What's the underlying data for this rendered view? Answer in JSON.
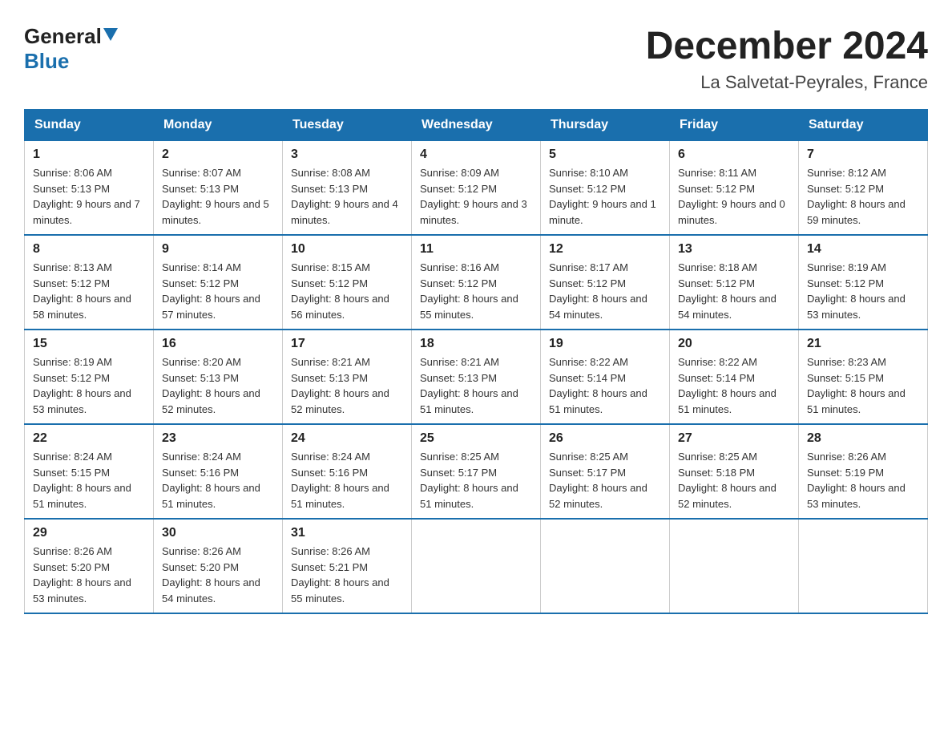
{
  "logo": {
    "general": "General",
    "blue": "Blue",
    "arrow_color": "#1a6fad"
  },
  "header": {
    "title": "December 2024",
    "subtitle": "La Salvetat-Peyrales, France"
  },
  "days_of_week": [
    "Sunday",
    "Monday",
    "Tuesday",
    "Wednesday",
    "Thursday",
    "Friday",
    "Saturday"
  ],
  "weeks": [
    [
      {
        "day": "1",
        "sunrise": "8:06 AM",
        "sunset": "5:13 PM",
        "daylight": "9 hours and 7 minutes."
      },
      {
        "day": "2",
        "sunrise": "8:07 AM",
        "sunset": "5:13 PM",
        "daylight": "9 hours and 5 minutes."
      },
      {
        "day": "3",
        "sunrise": "8:08 AM",
        "sunset": "5:13 PM",
        "daylight": "9 hours and 4 minutes."
      },
      {
        "day": "4",
        "sunrise": "8:09 AM",
        "sunset": "5:12 PM",
        "daylight": "9 hours and 3 minutes."
      },
      {
        "day": "5",
        "sunrise": "8:10 AM",
        "sunset": "5:12 PM",
        "daylight": "9 hours and 1 minute."
      },
      {
        "day": "6",
        "sunrise": "8:11 AM",
        "sunset": "5:12 PM",
        "daylight": "9 hours and 0 minutes."
      },
      {
        "day": "7",
        "sunrise": "8:12 AM",
        "sunset": "5:12 PM",
        "daylight": "8 hours and 59 minutes."
      }
    ],
    [
      {
        "day": "8",
        "sunrise": "8:13 AM",
        "sunset": "5:12 PM",
        "daylight": "8 hours and 58 minutes."
      },
      {
        "day": "9",
        "sunrise": "8:14 AM",
        "sunset": "5:12 PM",
        "daylight": "8 hours and 57 minutes."
      },
      {
        "day": "10",
        "sunrise": "8:15 AM",
        "sunset": "5:12 PM",
        "daylight": "8 hours and 56 minutes."
      },
      {
        "day": "11",
        "sunrise": "8:16 AM",
        "sunset": "5:12 PM",
        "daylight": "8 hours and 55 minutes."
      },
      {
        "day": "12",
        "sunrise": "8:17 AM",
        "sunset": "5:12 PM",
        "daylight": "8 hours and 54 minutes."
      },
      {
        "day": "13",
        "sunrise": "8:18 AM",
        "sunset": "5:12 PM",
        "daylight": "8 hours and 54 minutes."
      },
      {
        "day": "14",
        "sunrise": "8:19 AM",
        "sunset": "5:12 PM",
        "daylight": "8 hours and 53 minutes."
      }
    ],
    [
      {
        "day": "15",
        "sunrise": "8:19 AM",
        "sunset": "5:12 PM",
        "daylight": "8 hours and 53 minutes."
      },
      {
        "day": "16",
        "sunrise": "8:20 AM",
        "sunset": "5:13 PM",
        "daylight": "8 hours and 52 minutes."
      },
      {
        "day": "17",
        "sunrise": "8:21 AM",
        "sunset": "5:13 PM",
        "daylight": "8 hours and 52 minutes."
      },
      {
        "day": "18",
        "sunrise": "8:21 AM",
        "sunset": "5:13 PM",
        "daylight": "8 hours and 51 minutes."
      },
      {
        "day": "19",
        "sunrise": "8:22 AM",
        "sunset": "5:14 PM",
        "daylight": "8 hours and 51 minutes."
      },
      {
        "day": "20",
        "sunrise": "8:22 AM",
        "sunset": "5:14 PM",
        "daylight": "8 hours and 51 minutes."
      },
      {
        "day": "21",
        "sunrise": "8:23 AM",
        "sunset": "5:15 PM",
        "daylight": "8 hours and 51 minutes."
      }
    ],
    [
      {
        "day": "22",
        "sunrise": "8:24 AM",
        "sunset": "5:15 PM",
        "daylight": "8 hours and 51 minutes."
      },
      {
        "day": "23",
        "sunrise": "8:24 AM",
        "sunset": "5:16 PM",
        "daylight": "8 hours and 51 minutes."
      },
      {
        "day": "24",
        "sunrise": "8:24 AM",
        "sunset": "5:16 PM",
        "daylight": "8 hours and 51 minutes."
      },
      {
        "day": "25",
        "sunrise": "8:25 AM",
        "sunset": "5:17 PM",
        "daylight": "8 hours and 51 minutes."
      },
      {
        "day": "26",
        "sunrise": "8:25 AM",
        "sunset": "5:17 PM",
        "daylight": "8 hours and 52 minutes."
      },
      {
        "day": "27",
        "sunrise": "8:25 AM",
        "sunset": "5:18 PM",
        "daylight": "8 hours and 52 minutes."
      },
      {
        "day": "28",
        "sunrise": "8:26 AM",
        "sunset": "5:19 PM",
        "daylight": "8 hours and 53 minutes."
      }
    ],
    [
      {
        "day": "29",
        "sunrise": "8:26 AM",
        "sunset": "5:20 PM",
        "daylight": "8 hours and 53 minutes."
      },
      {
        "day": "30",
        "sunrise": "8:26 AM",
        "sunset": "5:20 PM",
        "daylight": "8 hours and 54 minutes."
      },
      {
        "day": "31",
        "sunrise": "8:26 AM",
        "sunset": "5:21 PM",
        "daylight": "8 hours and 55 minutes."
      },
      null,
      null,
      null,
      null
    ]
  ],
  "labels": {
    "sunrise": "Sunrise:",
    "sunset": "Sunset:",
    "daylight": "Daylight:"
  }
}
